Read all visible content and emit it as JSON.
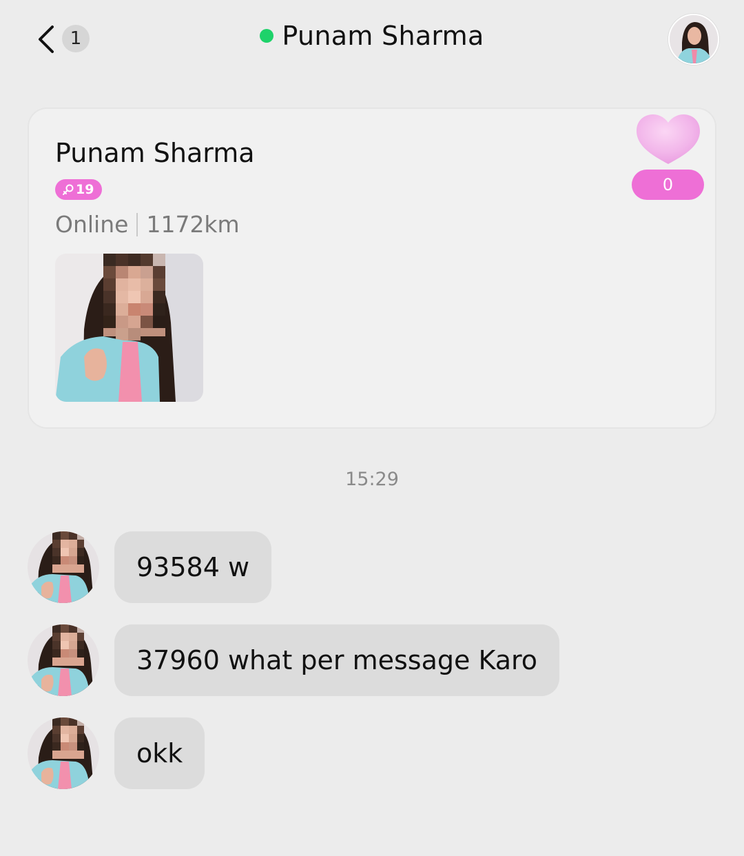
{
  "header": {
    "back_icon": "chevron-left-icon",
    "unread_count": "1",
    "title": "Punam Sharma",
    "online_color": "#1ed26a"
  },
  "profile_card": {
    "name": "Punam Sharma",
    "age_badge": {
      "icon": "female-symbol-icon",
      "age": "19",
      "color": "#ee6fd6"
    },
    "status": "Online",
    "distance": "1172km",
    "like_count": "0",
    "heart_icon": "heart-icon"
  },
  "timestamp": "15:29",
  "messages": [
    {
      "text": "93584 w"
    },
    {
      "text": "37960 what per message Karo"
    },
    {
      "text": "okk"
    }
  ]
}
